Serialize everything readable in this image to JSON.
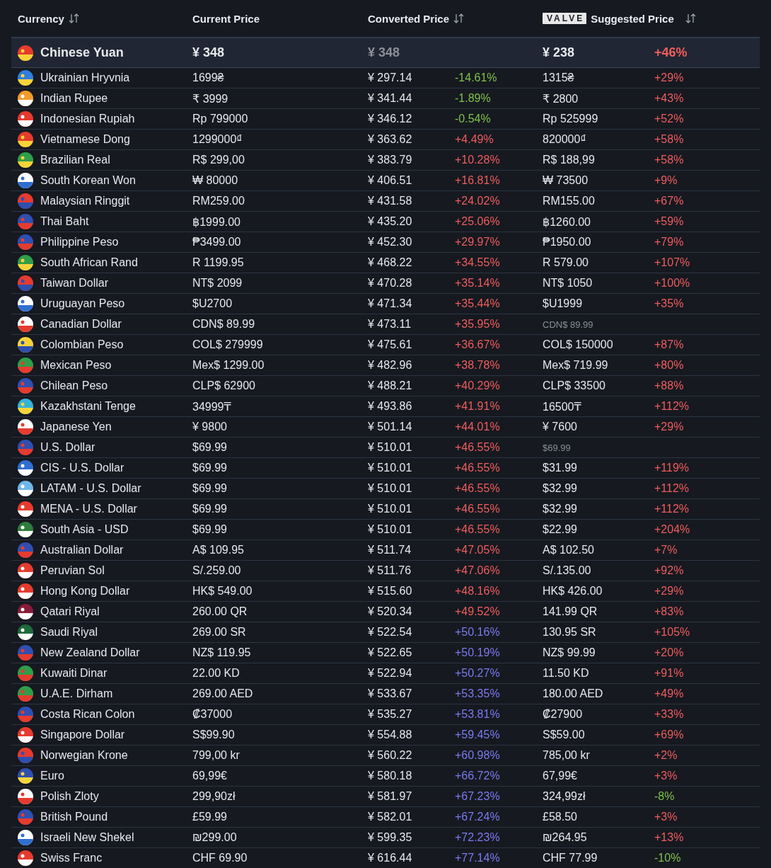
{
  "header": {
    "currency": "Currency",
    "current": "Current Price",
    "converted": "Converted Price",
    "logo": "VALVE",
    "suggested": "Suggested Price"
  },
  "base": {
    "currency": "Chinese Yuan",
    "current": "¥ 348",
    "converted": "¥ 348",
    "suggested": "¥ 238",
    "suggested_diff": {
      "text": "+46%",
      "color": "#f05d5d"
    }
  },
  "rows": [
    {
      "currency": "Ukrainian Hryvnia",
      "current": "1699₴",
      "converted": "¥ 297.14",
      "diff": {
        "text": "-14.61%",
        "color": "#7fc24a"
      },
      "suggested": "1315₴",
      "muted": false,
      "suggested_diff": {
        "text": "+29%",
        "color": "#f05d5d"
      }
    },
    {
      "currency": "Indian Rupee",
      "current": "₹ 3999",
      "converted": "¥ 341.44",
      "diff": {
        "text": "-1.89%",
        "color": "#7fc24a"
      },
      "suggested": "₹ 2800",
      "muted": false,
      "suggested_diff": {
        "text": "+43%",
        "color": "#f05d5d"
      }
    },
    {
      "currency": "Indonesian Rupiah",
      "current": "Rp 799000",
      "converted": "¥ 346.12",
      "diff": {
        "text": "-0.54%",
        "color": "#7fc24a"
      },
      "suggested": "Rp 525999",
      "muted": false,
      "suggested_diff": {
        "text": "+52%",
        "color": "#f05d5d"
      }
    },
    {
      "currency": "Vietnamese Dong",
      "current": "1299000₫",
      "converted": "¥ 363.62",
      "diff": {
        "text": "+4.49%",
        "color": "#f05d5d"
      },
      "suggested": "820000₫",
      "muted": false,
      "suggested_diff": {
        "text": "+58%",
        "color": "#f05d5d"
      }
    },
    {
      "currency": "Brazilian Real",
      "current": "R$ 299,00",
      "converted": "¥ 383.79",
      "diff": {
        "text": "+10.28%",
        "color": "#f05d5d"
      },
      "suggested": "R$ 188,99",
      "muted": false,
      "suggested_diff": {
        "text": "+58%",
        "color": "#f05d5d"
      }
    },
    {
      "currency": "South Korean Won",
      "current": "₩ 80000",
      "converted": "¥ 406.51",
      "diff": {
        "text": "+16.81%",
        "color": "#f05d5d"
      },
      "suggested": "₩ 73500",
      "muted": false,
      "suggested_diff": {
        "text": "+9%",
        "color": "#f05d5d"
      }
    },
    {
      "currency": "Malaysian Ringgit",
      "current": "RM259.00",
      "converted": "¥ 431.58",
      "diff": {
        "text": "+24.02%",
        "color": "#f05d5d"
      },
      "suggested": "RM155.00",
      "muted": false,
      "suggested_diff": {
        "text": "+67%",
        "color": "#f05d5d"
      }
    },
    {
      "currency": "Thai Baht",
      "current": "฿1999.00",
      "converted": "¥ 435.20",
      "diff": {
        "text": "+25.06%",
        "color": "#f05d5d"
      },
      "suggested": "฿1260.00",
      "muted": false,
      "suggested_diff": {
        "text": "+59%",
        "color": "#f05d5d"
      }
    },
    {
      "currency": "Philippine Peso",
      "current": "₱3499.00",
      "converted": "¥ 452.30",
      "diff": {
        "text": "+29.97%",
        "color": "#f05d5d"
      },
      "suggested": "₱1950.00",
      "muted": false,
      "suggested_diff": {
        "text": "+79%",
        "color": "#f05d5d"
      }
    },
    {
      "currency": "South African Rand",
      "current": "R 1199.95",
      "converted": "¥ 468.22",
      "diff": {
        "text": "+34.55%",
        "color": "#f05d5d"
      },
      "suggested": "R 579.00",
      "muted": false,
      "suggested_diff": {
        "text": "+107%",
        "color": "#f05d5d"
      }
    },
    {
      "currency": "Taiwan Dollar",
      "current": "NT$ 2099",
      "converted": "¥ 470.28",
      "diff": {
        "text": "+35.14%",
        "color": "#f05d5d"
      },
      "suggested": "NT$ 1050",
      "muted": false,
      "suggested_diff": {
        "text": "+100%",
        "color": "#f05d5d"
      }
    },
    {
      "currency": "Uruguayan Peso",
      "current": "$U2700",
      "converted": "¥ 471.34",
      "diff": {
        "text": "+35.44%",
        "color": "#f05d5d"
      },
      "suggested": "$U1999",
      "muted": false,
      "suggested_diff": {
        "text": "+35%",
        "color": "#f05d5d"
      }
    },
    {
      "currency": "Canadian Dollar",
      "current": "CDN$ 89.99",
      "converted": "¥ 473.11",
      "diff": {
        "text": "+35.95%",
        "color": "#f05d5d"
      },
      "suggested": "CDN$ 89.99",
      "muted": true
    },
    {
      "currency": "Colombian Peso",
      "current": "COL$ 279999",
      "converted": "¥ 475.61",
      "diff": {
        "text": "+36.67%",
        "color": "#f05d5d"
      },
      "suggested": "COL$ 150000",
      "muted": false,
      "suggested_diff": {
        "text": "+87%",
        "color": "#f05d5d"
      }
    },
    {
      "currency": "Mexican Peso",
      "current": "Mex$ 1299.00",
      "converted": "¥ 482.96",
      "diff": {
        "text": "+38.78%",
        "color": "#f05d5d"
      },
      "suggested": "Mex$ 719.99",
      "muted": false,
      "suggested_diff": {
        "text": "+80%",
        "color": "#f05d5d"
      }
    },
    {
      "currency": "Chilean Peso",
      "current": "CLP$ 62900",
      "converted": "¥ 488.21",
      "diff": {
        "text": "+40.29%",
        "color": "#f05d5d"
      },
      "suggested": "CLP$ 33500",
      "muted": false,
      "suggested_diff": {
        "text": "+88%",
        "color": "#f05d5d"
      }
    },
    {
      "currency": "Kazakhstani Tenge",
      "current": "34999₸",
      "converted": "¥ 493.86",
      "diff": {
        "text": "+41.91%",
        "color": "#f05d5d"
      },
      "suggested": "16500₸",
      "muted": false,
      "suggested_diff": {
        "text": "+112%",
        "color": "#f05d5d"
      }
    },
    {
      "currency": "Japanese Yen",
      "current": "¥ 9800",
      "converted": "¥ 501.14",
      "diff": {
        "text": "+44.01%",
        "color": "#f05d5d"
      },
      "suggested": "¥ 7600",
      "muted": false,
      "suggested_diff": {
        "text": "+29%",
        "color": "#f05d5d"
      }
    },
    {
      "currency": "U.S. Dollar",
      "current": "$69.99",
      "converted": "¥ 510.01",
      "diff": {
        "text": "+46.55%",
        "color": "#f05d5d"
      },
      "suggested": "$69.99",
      "muted": true
    },
    {
      "currency": "CIS - U.S. Dollar",
      "current": "$69.99",
      "converted": "¥ 510.01",
      "diff": {
        "text": "+46.55%",
        "color": "#f05d5d"
      },
      "suggested": "$31.99",
      "muted": false,
      "suggested_diff": {
        "text": "+119%",
        "color": "#f05d5d"
      }
    },
    {
      "currency": "LATAM - U.S. Dollar",
      "current": "$69.99",
      "converted": "¥ 510.01",
      "diff": {
        "text": "+46.55%",
        "color": "#f05d5d"
      },
      "suggested": "$32.99",
      "muted": false,
      "suggested_diff": {
        "text": "+112%",
        "color": "#f05d5d"
      }
    },
    {
      "currency": "MENA - U.S. Dollar",
      "current": "$69.99",
      "converted": "¥ 510.01",
      "diff": {
        "text": "+46.55%",
        "color": "#f05d5d"
      },
      "suggested": "$32.99",
      "muted": false,
      "suggested_diff": {
        "text": "+112%",
        "color": "#f05d5d"
      }
    },
    {
      "currency": "South Asia - USD",
      "current": "$69.99",
      "converted": "¥ 510.01",
      "diff": {
        "text": "+46.55%",
        "color": "#f05d5d"
      },
      "suggested": "$22.99",
      "muted": false,
      "suggested_diff": {
        "text": "+204%",
        "color": "#f05d5d"
      }
    },
    {
      "currency": "Australian Dollar",
      "current": "A$ 109.95",
      "converted": "¥ 511.74",
      "diff": {
        "text": "+47.05%",
        "color": "#f05d5d"
      },
      "suggested": "A$ 102.50",
      "muted": false,
      "suggested_diff": {
        "text": "+7%",
        "color": "#f05d5d"
      }
    },
    {
      "currency": "Peruvian Sol",
      "current": "S/.259.00",
      "converted": "¥ 511.76",
      "diff": {
        "text": "+47.06%",
        "color": "#f05d5d"
      },
      "suggested": "S/.135.00",
      "muted": false,
      "suggested_diff": {
        "text": "+92%",
        "color": "#f05d5d"
      }
    },
    {
      "currency": "Hong Kong Dollar",
      "current": "HK$ 549.00",
      "converted": "¥ 515.60",
      "diff": {
        "text": "+48.16%",
        "color": "#f05d5d"
      },
      "suggested": "HK$ 426.00",
      "muted": false,
      "suggested_diff": {
        "text": "+29%",
        "color": "#f05d5d"
      }
    },
    {
      "currency": "Qatari Riyal",
      "current": "260.00 QR",
      "converted": "¥ 520.34",
      "diff": {
        "text": "+49.52%",
        "color": "#f05d5d"
      },
      "suggested": "141.99 QR",
      "muted": false,
      "suggested_diff": {
        "text": "+83%",
        "color": "#f05d5d"
      }
    },
    {
      "currency": "Saudi Riyal",
      "current": "269.00 SR",
      "converted": "¥ 522.54",
      "diff": {
        "text": "+50.16%",
        "color": "#7b7bf0"
      },
      "suggested": "130.95 SR",
      "muted": false,
      "suggested_diff": {
        "text": "+105%",
        "color": "#f05d5d"
      }
    },
    {
      "currency": "New Zealand Dollar",
      "current": "NZ$ 119.95",
      "converted": "¥ 522.65",
      "diff": {
        "text": "+50.19%",
        "color": "#7b7bf0"
      },
      "suggested": "NZ$ 99.99",
      "muted": false,
      "suggested_diff": {
        "text": "+20%",
        "color": "#f05d5d"
      }
    },
    {
      "currency": "Kuwaiti Dinar",
      "current": "22.00 KD",
      "converted": "¥ 522.94",
      "diff": {
        "text": "+50.27%",
        "color": "#7b7bf0"
      },
      "suggested": "11.50 KD",
      "muted": false,
      "suggested_diff": {
        "text": "+91%",
        "color": "#f05d5d"
      }
    },
    {
      "currency": "U.A.E. Dirham",
      "current": "269.00 AED",
      "converted": "¥ 533.67",
      "diff": {
        "text": "+53.35%",
        "color": "#7b7bf0"
      },
      "suggested": "180.00 AED",
      "muted": false,
      "suggested_diff": {
        "text": "+49%",
        "color": "#f05d5d"
      }
    },
    {
      "currency": "Costa Rican Colon",
      "current": "₡37000",
      "converted": "¥ 535.27",
      "diff": {
        "text": "+53.81%",
        "color": "#7b7bf0"
      },
      "suggested": "₡27900",
      "muted": false,
      "suggested_diff": {
        "text": "+33%",
        "color": "#f05d5d"
      }
    },
    {
      "currency": "Singapore Dollar",
      "current": "S$99.90",
      "converted": "¥ 554.88",
      "diff": {
        "text": "+59.45%",
        "color": "#7b7bf0"
      },
      "suggested": "S$59.00",
      "muted": false,
      "suggested_diff": {
        "text": "+69%",
        "color": "#f05d5d"
      }
    },
    {
      "currency": "Norwegian Krone",
      "current": "799,00 kr",
      "converted": "¥ 560.22",
      "diff": {
        "text": "+60.98%",
        "color": "#7b7bf0"
      },
      "suggested": "785,00 kr",
      "muted": false,
      "suggested_diff": {
        "text": "+2%",
        "color": "#f05d5d"
      }
    },
    {
      "currency": "Euro",
      "current": "69,99€",
      "converted": "¥ 580.18",
      "diff": {
        "text": "+66.72%",
        "color": "#7b7bf0"
      },
      "suggested": "67,99€",
      "muted": false,
      "suggested_diff": {
        "text": "+3%",
        "color": "#f05d5d"
      }
    },
    {
      "currency": "Polish Zloty",
      "current": "299,90zł",
      "converted": "¥ 581.97",
      "diff": {
        "text": "+67.23%",
        "color": "#7b7bf0"
      },
      "suggested": "324,99zł",
      "muted": false,
      "suggested_diff": {
        "text": "-8%",
        "color": "#7fc24a"
      }
    },
    {
      "currency": "British Pound",
      "current": "£59.99",
      "converted": "¥ 582.01",
      "diff": {
        "text": "+67.24%",
        "color": "#7b7bf0"
      },
      "suggested": "£58.50",
      "muted": false,
      "suggested_diff": {
        "text": "+3%",
        "color": "#f05d5d"
      }
    },
    {
      "currency": "Israeli New Shekel",
      "current": "₪299.00",
      "converted": "¥ 599.35",
      "diff": {
        "text": "+72.23%",
        "color": "#7b7bf0"
      },
      "suggested": "₪264.95",
      "muted": false,
      "suggested_diff": {
        "text": "+13%",
        "color": "#f05d5d"
      }
    },
    {
      "currency": "Swiss Franc",
      "current": "CHF 69.90",
      "converted": "¥ 616.44",
      "diff": {
        "text": "+77.14%",
        "color": "#7b7bf0"
      },
      "suggested": "CHF 77.99",
      "muted": false,
      "suggested_diff": {
        "text": "-10%",
        "color": "#7fc24a"
      }
    }
  ]
}
